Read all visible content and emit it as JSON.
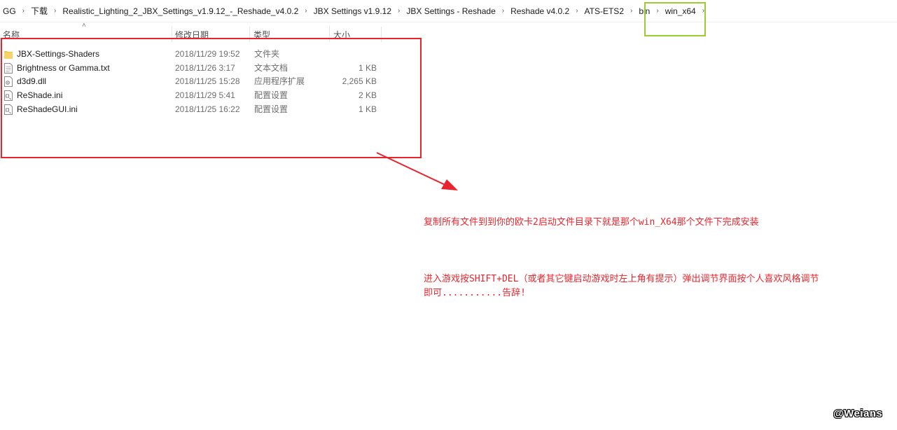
{
  "breadcrumb": {
    "items": [
      "GG",
      "下载",
      "Realistic_Lighting_2_JBX_Settings_v1.9.12_-_Reshade_v4.0.2",
      "JBX Settings v1.9.12",
      "JBX Settings - Reshade",
      "Reshade v4.0.2",
      "ATS-ETS2",
      "bin",
      "win_x64"
    ]
  },
  "columns": {
    "name": "名称",
    "date": "修改日期",
    "type": "类型",
    "size": "大小"
  },
  "files": [
    {
      "name": "JBX-Settings-Shaders",
      "date": "2018/11/29 19:52",
      "type": "文件夹",
      "size": "",
      "icon": "folder-icon"
    },
    {
      "name": "Brightness or Gamma.txt",
      "date": "2018/11/26 3:17",
      "type": "文本文档",
      "size": "1 KB",
      "icon": "text-file-icon"
    },
    {
      "name": "d3d9.dll",
      "date": "2018/11/25 15:28",
      "type": "应用程序扩展",
      "size": "2,265 KB",
      "icon": "dll-file-icon"
    },
    {
      "name": "ReShade.ini",
      "date": "2018/11/29 5:41",
      "type": "配置设置",
      "size": "2 KB",
      "icon": "ini-file-icon"
    },
    {
      "name": "ReShadeGUI.ini",
      "date": "2018/11/25 16:22",
      "type": "配置设置",
      "size": "1 KB",
      "icon": "ini-file-icon"
    }
  ],
  "annotations": {
    "note1": "复制所有文件到到你的欧卡2启动文件目录下就是那个win_X64那个文件下完成安装",
    "note2": "进入游戏按SHIFT+DEL（或者其它键启动游戏时左上角有提示）弹出调节界面按个人喜欢风格调节即可...........告辞!"
  },
  "watermark": "@Weians",
  "colors": {
    "highlight_red": "#e8252d",
    "highlight_green": "#9acd32",
    "folder_yellow": "#f5c542"
  }
}
